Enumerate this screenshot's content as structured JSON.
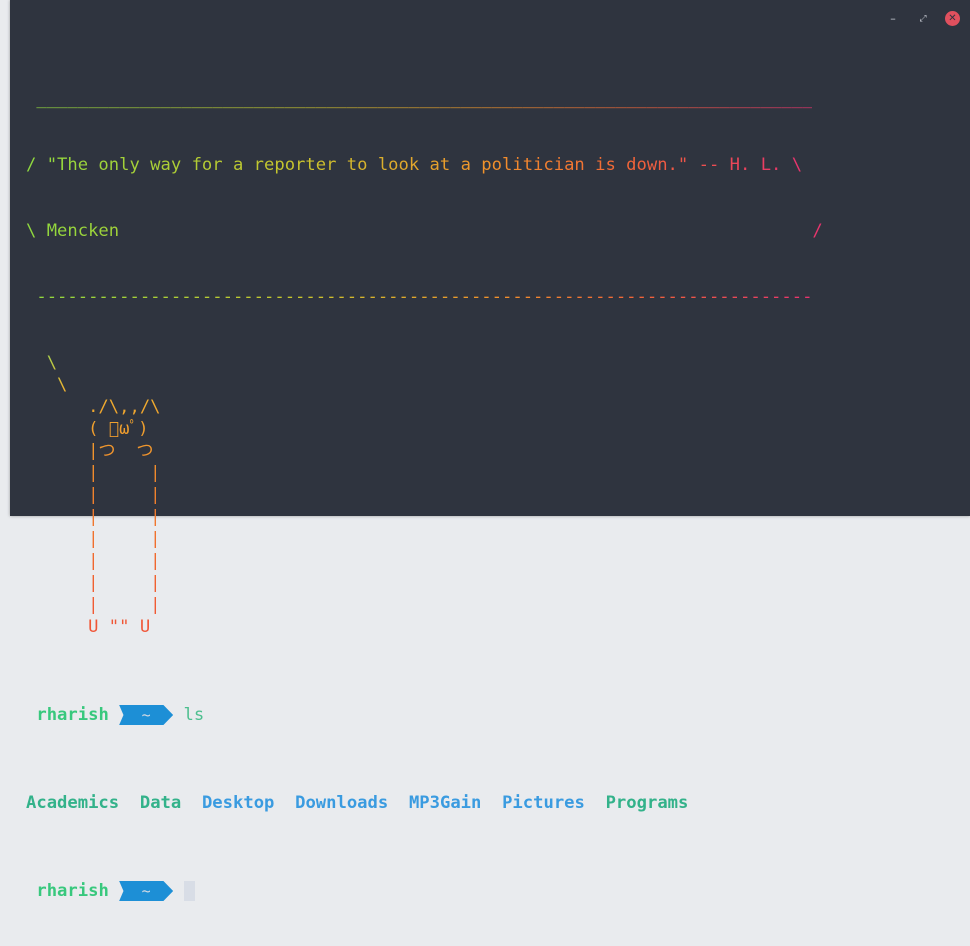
{
  "window": {
    "controls": {
      "minimize": "–",
      "maximize": "⤢",
      "close": "✕"
    }
  },
  "cowsay": {
    "top_border": " ___________________________________________________________________________",
    "quote_line1": "/ \"The only way for a reporter to look at a politician is down.\" -- H. L. \\",
    "quote_line2": "\\ Mencken                                                                   /",
    "bottom_border": " ---------------------------------------------------------------------------",
    "art": "  \\\n   \\\n      ./\\,,/\\\n      ( ﾟωﾟ)\n      |つ  つ\n      |     |\n      |     |\n      |     |\n      |     |\n      |     |\n      |     |\n      |     |\n      U \"\" U"
  },
  "prompt1": {
    "user": "rharish",
    "dir": "~",
    "command": "ls"
  },
  "ls_output": [
    "Academics",
    "Data",
    "Desktop",
    "Downloads",
    "MP3Gain",
    "Pictures",
    "Programs"
  ],
  "prompt2": {
    "user": "rharish",
    "dir": "~"
  },
  "colors": {
    "background": "#2f343f",
    "user": "#38c87d",
    "prompt_arrow": "#1d8fd6",
    "dir_blue": "#3a9be0",
    "dir_teal": "#33b28a"
  }
}
